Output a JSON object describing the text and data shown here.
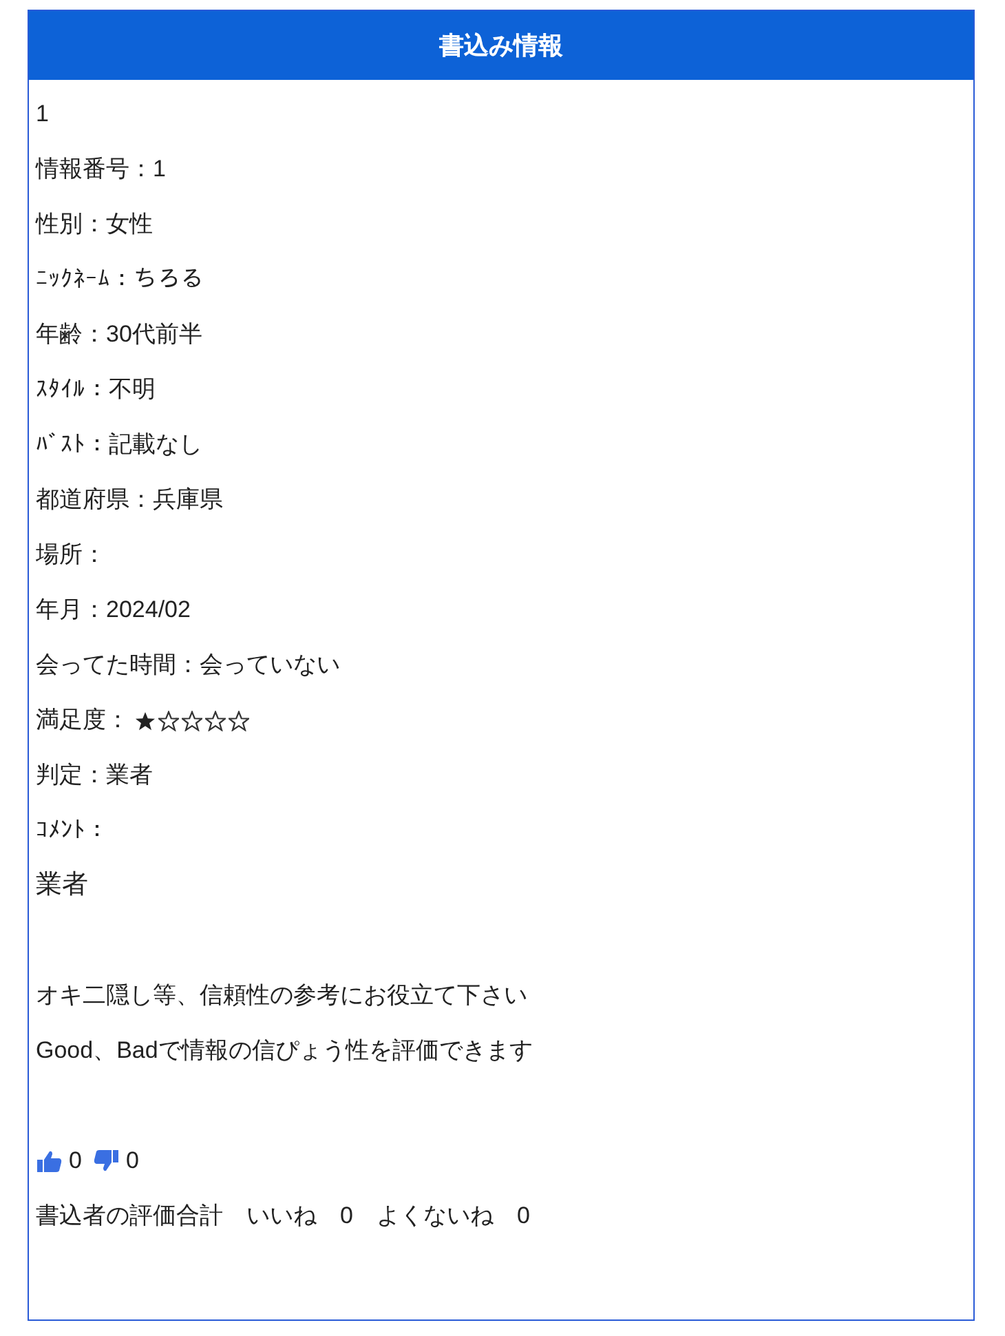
{
  "panel": {
    "title": "書込み情報"
  },
  "number": "1",
  "fields": [
    {
      "kind": "text",
      "text": "情報番号：1"
    },
    {
      "kind": "text",
      "text": "性別：女性"
    },
    {
      "kind": "text",
      "text": "ﾆｯｸﾈｰﾑ：ちろる"
    },
    {
      "kind": "text",
      "text": "年齢：30代前半"
    },
    {
      "kind": "text",
      "text": "ｽﾀｲﾙ：不明"
    },
    {
      "kind": "text",
      "text": "ﾊﾞｽﾄ：記載なし"
    },
    {
      "kind": "text",
      "text": "都道府県：兵庫県"
    },
    {
      "kind": "text",
      "text": "場所："
    },
    {
      "kind": "text",
      "text": "年月：2024/02"
    },
    {
      "kind": "text",
      "text": "会ってた時間：会っていない"
    },
    {
      "kind": "stars",
      "text": "満足度：",
      "stars": 1
    },
    {
      "kind": "text",
      "text": "判定：業者"
    },
    {
      "kind": "text",
      "text": "ｺﾒﾝﾄ："
    }
  ],
  "comment": "業者",
  "notes": [
    "オキ二隠し等、信頼性の参考にお役立て下さい",
    "Good、Badで情報の信ぴょう性を評価できます"
  ],
  "votes": {
    "good": "0",
    "bad": "0"
  },
  "summary": "書込者の評価合計　いいね　0　よくないね　0"
}
